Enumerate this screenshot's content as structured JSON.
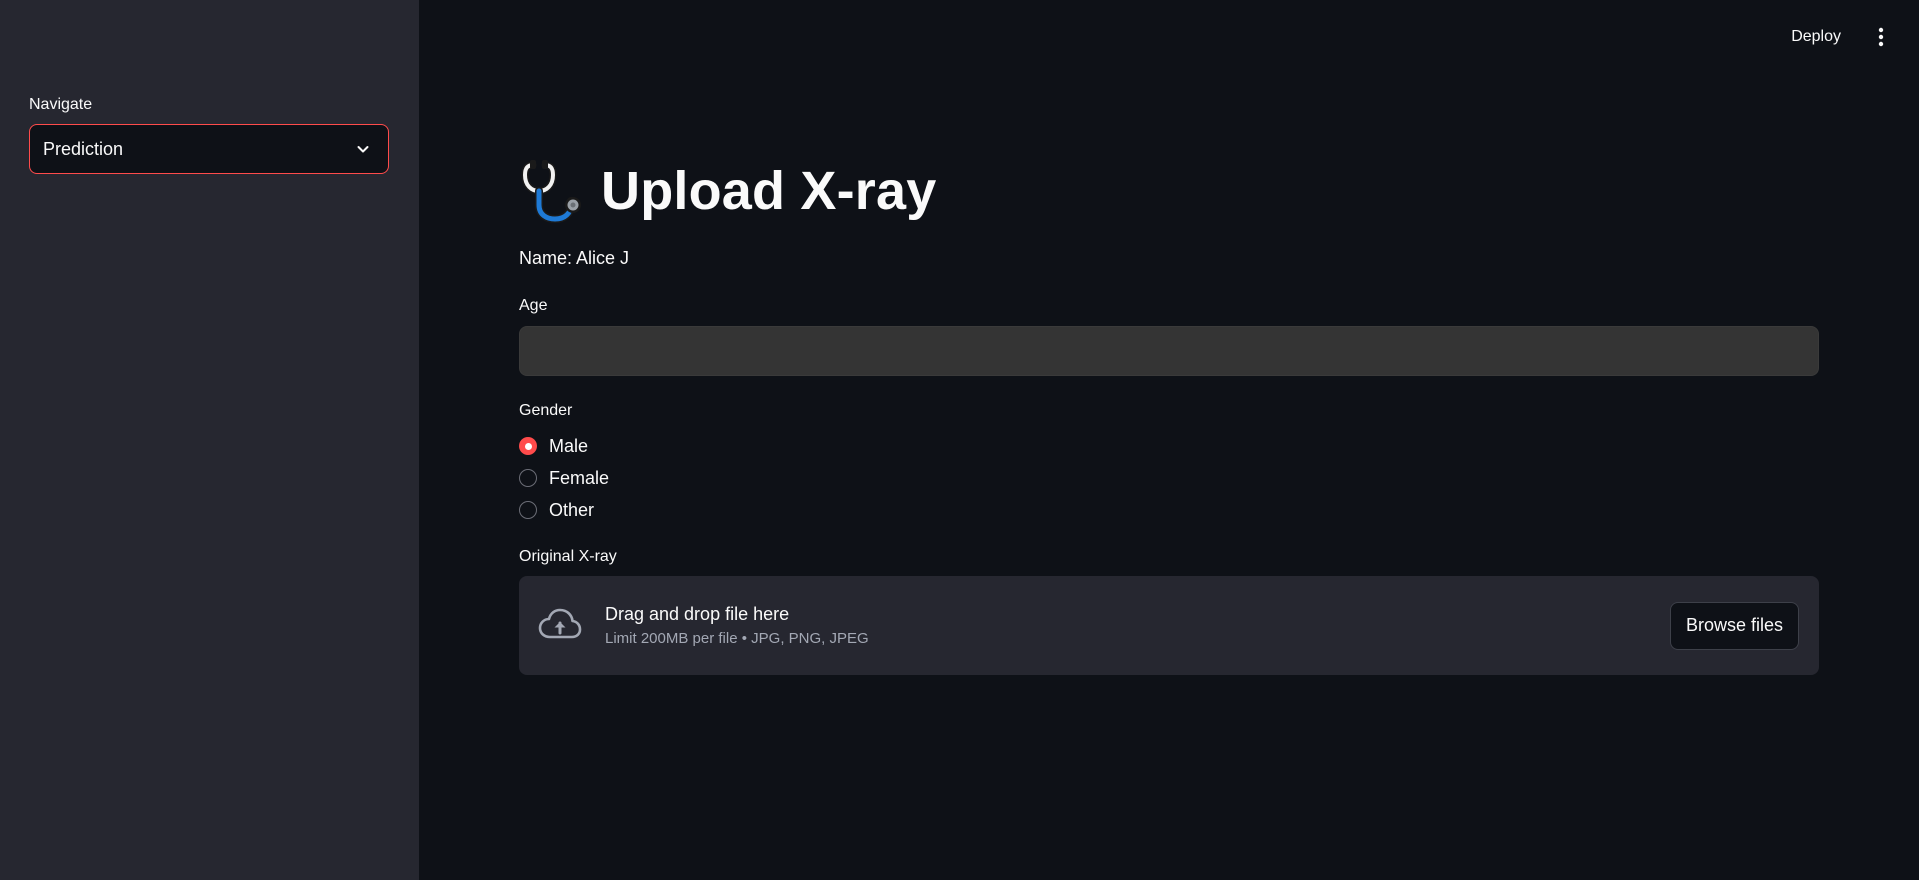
{
  "sidebar": {
    "nav_label": "Navigate",
    "nav_selected": "Prediction"
  },
  "toolbar": {
    "deploy_label": "Deploy",
    "menu_icon": "kebab-vertical-icon"
  },
  "main": {
    "title_icon": "stethoscope-icon",
    "title": "Upload X-ray",
    "name_line": "Name: Alice J",
    "age": {
      "label": "Age",
      "value": ""
    },
    "gender": {
      "label": "Gender",
      "options": [
        "Male",
        "Female",
        "Other"
      ],
      "selected": "Male"
    },
    "xray": {
      "label": "Original X-ray",
      "drop_title": "Drag and drop file here",
      "drop_subtitle": "Limit 200MB per file • JPG, PNG, JPEG",
      "browse_label": "Browse files",
      "icon": "cloud-upload-icon"
    }
  },
  "colors": {
    "accent": "#ff4b4b",
    "background": "#0e1117",
    "sidebar": "#262730",
    "input_bg": "#343434"
  }
}
